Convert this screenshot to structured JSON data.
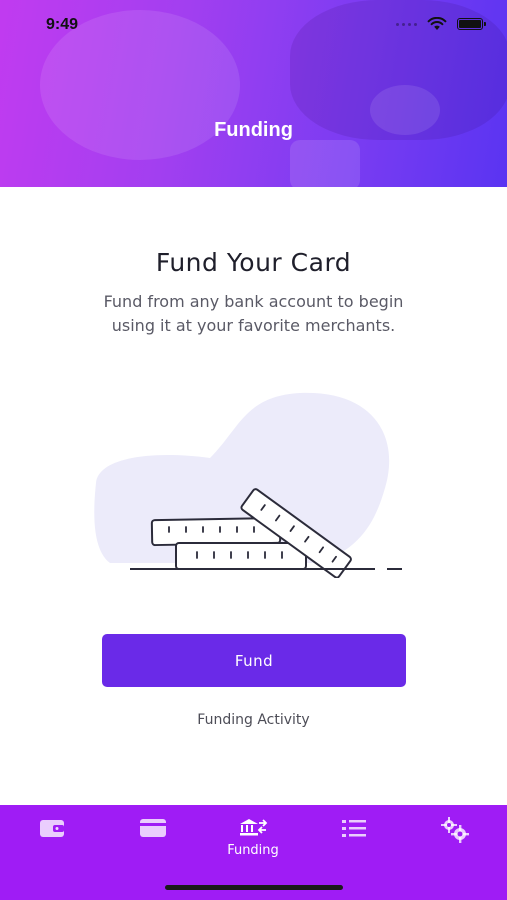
{
  "status_bar": {
    "time": "9:49"
  },
  "header": {
    "title": "Funding"
  },
  "main": {
    "title": "Fund Your Card",
    "subtitle_line1": "Fund from any bank account to begin",
    "subtitle_line2": "using it at your favorite merchants.",
    "fund_button_label": "Fund",
    "activity_link_label": "Funding Activity"
  },
  "tabbar": {
    "tabs": [
      {
        "icon": "wallet-icon",
        "label": ""
      },
      {
        "icon": "credit-card-icon",
        "label": ""
      },
      {
        "icon": "bank-transfer-icon",
        "label": "Funding",
        "active": true
      },
      {
        "icon": "list-icon",
        "label": ""
      },
      {
        "icon": "settings-gears-icon",
        "label": ""
      }
    ]
  },
  "colors": {
    "header_gradient_start": "#c13bf0",
    "header_gradient_end": "#5a34f2",
    "accent": "#6a2ae8",
    "tabbar": "#9f1cf5"
  }
}
